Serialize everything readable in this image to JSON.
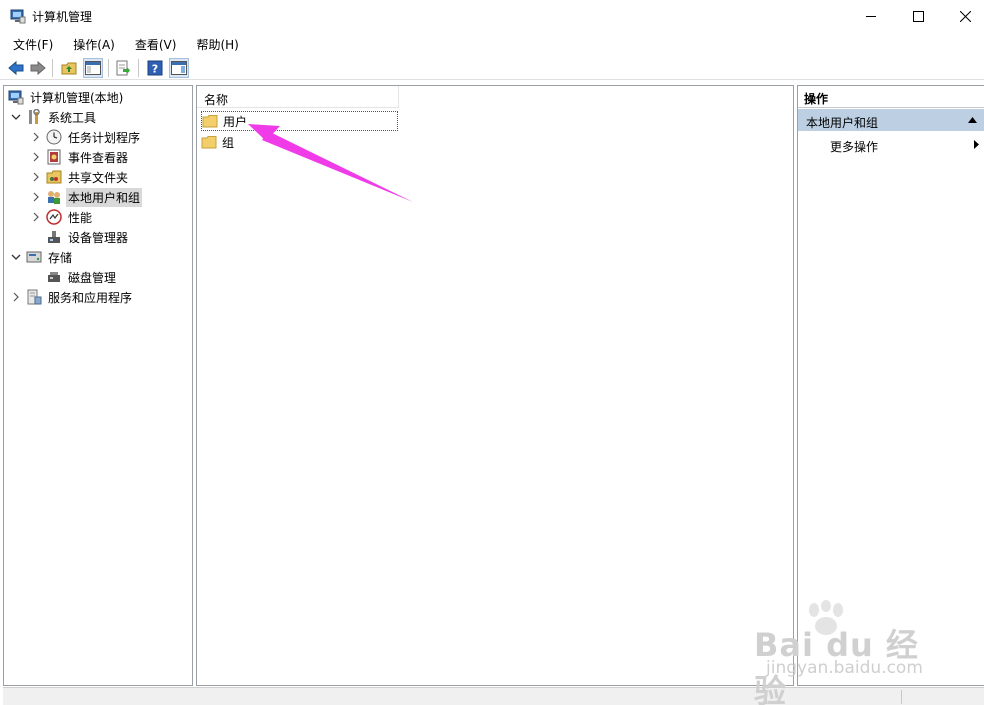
{
  "window": {
    "title": "计算机管理",
    "controls": [
      "minimize-icon",
      "maximize-icon",
      "close-icon"
    ]
  },
  "menu": [
    "文件(F)",
    "操作(A)",
    "查看(V)",
    "帮助(H)"
  ],
  "toolbar": {
    "buttons": [
      "back-arrow-icon",
      "forward-arrow-icon",
      "up-folder-icon",
      "show-hide-console-tree-icon",
      "export-list-icon",
      "help-icon",
      "show-hide-action-pane-icon"
    ]
  },
  "tree": {
    "root": "计算机管理(本地)",
    "items": [
      {
        "label": "系统工具",
        "icon": "tools-icon",
        "expanded": true
      },
      {
        "label": "任务计划程序",
        "icon": "clock-icon"
      },
      {
        "label": "事件查看器",
        "icon": "event-viewer-icon"
      },
      {
        "label": "共享文件夹",
        "icon": "shared-folder-icon"
      },
      {
        "label": "本地用户和组",
        "icon": "users-icon",
        "selected": true
      },
      {
        "label": "性能",
        "icon": "performance-icon"
      },
      {
        "label": "设备管理器",
        "icon": "device-manager-icon"
      },
      {
        "label": "存储",
        "icon": "storage-icon",
        "expanded": true
      },
      {
        "label": "磁盘管理",
        "icon": "disk-icon"
      },
      {
        "label": "服务和应用程序",
        "icon": "services-icon"
      }
    ]
  },
  "list": {
    "column": "名称",
    "items": [
      {
        "label": "用户",
        "icon": "folder-icon"
      },
      {
        "label": "组",
        "icon": "folder-icon"
      }
    ]
  },
  "actions": {
    "header": "操作",
    "group": "本地用户和组",
    "more": "更多操作"
  },
  "annotation": {
    "color": "#f03ce8"
  },
  "watermark": {
    "line1": "Bai du 经验",
    "line2": "jingyan.baidu.com"
  }
}
